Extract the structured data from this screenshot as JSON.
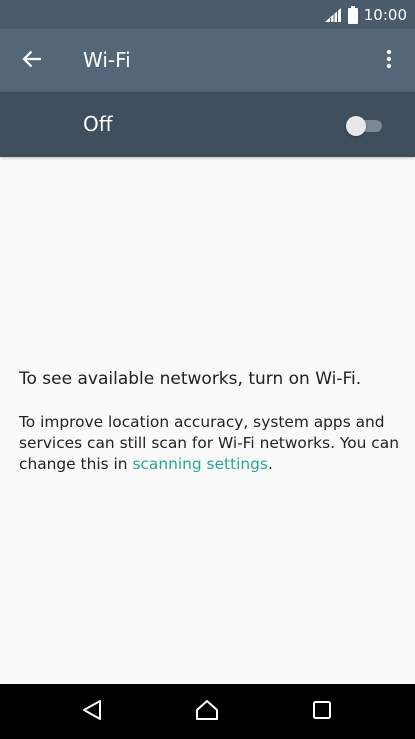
{
  "status_bar": {
    "time": "10:00",
    "icons": [
      "signal-icon",
      "battery-icon"
    ]
  },
  "app_bar": {
    "title": "Wi-Fi",
    "back_icon": "arrow-left-icon",
    "overflow_icon": "more-vert-icon"
  },
  "wifi_toggle": {
    "label": "Off",
    "state": "off"
  },
  "content": {
    "headline": "To see available networks, turn on Wi-Fi.",
    "body_prefix": "To improve location accuracy, system apps and services can still scan for Wi-Fi networks. You can change this in ",
    "link_text": "scanning settings",
    "body_suffix": "."
  },
  "nav_bar": {
    "icons": [
      "back-triangle-icon",
      "home-icon",
      "recents-icon"
    ]
  },
  "colors": {
    "status_bar": "#4a5b6b",
    "app_bar": "#546779",
    "toggle_bar": "#3f4e5c",
    "background": "#fafafa",
    "link": "#26a69a",
    "nav_bar": "#000000"
  }
}
